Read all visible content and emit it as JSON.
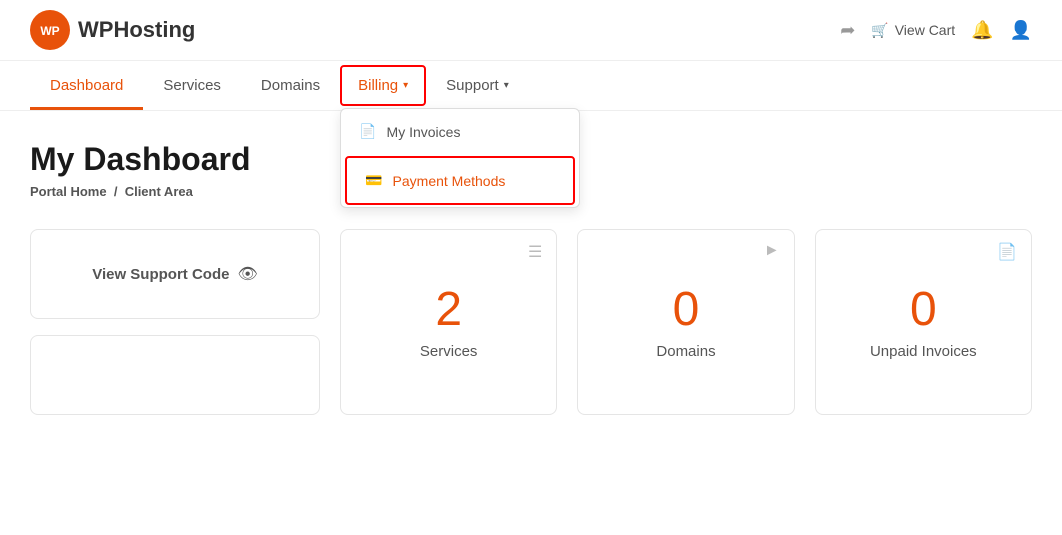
{
  "header": {
    "logo_initials": "WP",
    "logo_brand": "WP",
    "logo_suffix": "Hosting",
    "view_cart_label": "View Cart"
  },
  "nav": {
    "items": [
      {
        "id": "dashboard",
        "label": "Dashboard",
        "active": true
      },
      {
        "id": "services",
        "label": "Services",
        "active": false
      },
      {
        "id": "domains",
        "label": "Domains",
        "active": false
      },
      {
        "id": "billing",
        "label": "Billing",
        "active": false,
        "dropdown": true,
        "highlighted": true
      },
      {
        "id": "support",
        "label": "Support",
        "active": false,
        "dropdown": true
      }
    ]
  },
  "billing_dropdown": {
    "items": [
      {
        "id": "my-invoices",
        "label": "My Invoices",
        "icon": "📄"
      },
      {
        "id": "payment-methods",
        "label": "Payment Methods",
        "icon": "💳",
        "highlighted": true
      }
    ]
  },
  "main": {
    "title": "My Dashboard",
    "breadcrumb_home": "Portal Home",
    "breadcrumb_sep": "/",
    "breadcrumb_current": "Client Area"
  },
  "cards": {
    "support_code_label": "View Support Code",
    "metrics": [
      {
        "id": "services",
        "number": "2",
        "label": "Services",
        "icon": "≡"
      },
      {
        "id": "domains",
        "number": "0",
        "label": "Domains",
        "icon": "▶"
      },
      {
        "id": "unpaid-invoices",
        "number": "0",
        "label": "Unpaid Invoices",
        "icon": "📄"
      }
    ]
  }
}
